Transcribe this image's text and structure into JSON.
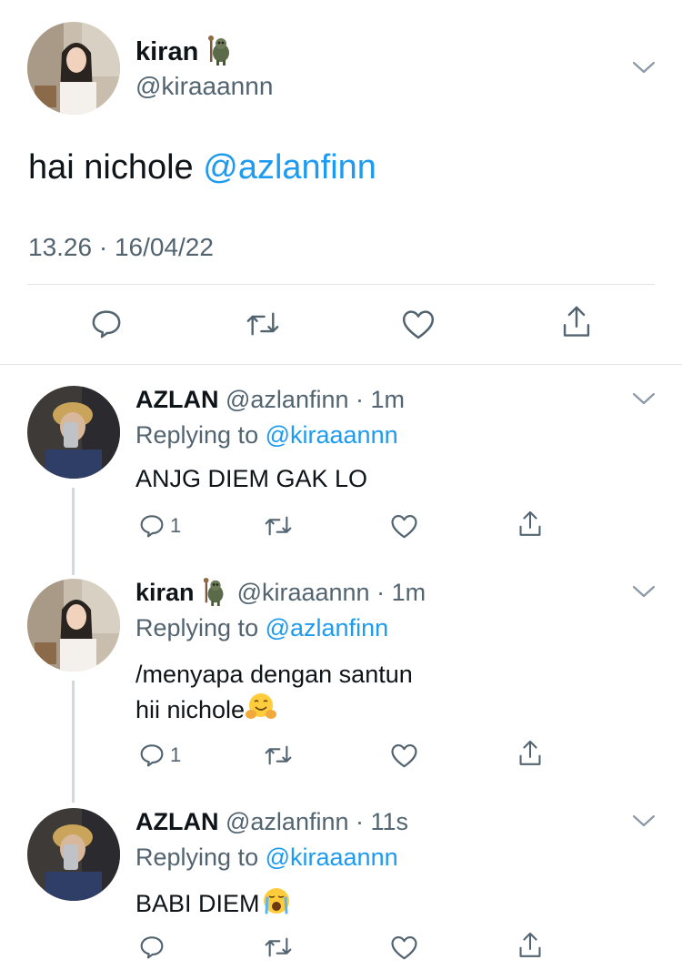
{
  "main_tweet": {
    "display_name": "kiran",
    "handle": "@kiraaannn",
    "text": "hai nichole",
    "mention": "@azlanfinn",
    "timestamp": "13.26 · 16/04/22"
  },
  "replies": [
    {
      "display_name": "AZLAN",
      "handle": "@azlanfinn",
      "time": "· 1m",
      "replying_label": "Replying to",
      "replying_to": "@kiraaannn",
      "text_lines": [
        "ANJG DIEM GAK LO"
      ],
      "reply_count": "1"
    },
    {
      "display_name": "kiran",
      "handle": "@kiraaannn",
      "time": "· 1m",
      "replying_label": "Replying to",
      "replying_to": "@azlanfinn",
      "text_lines": [
        "/menyapa dengan santun",
        "hii nichole"
      ],
      "reply_count": "1"
    },
    {
      "display_name": "AZLAN",
      "handle": "@azlanfinn",
      "time": "· 11s",
      "replying_label": "Replying to",
      "replying_to": "@kiraaannn",
      "text_lines": [
        "BABI DIEM"
      ],
      "reply_count": ""
    }
  ],
  "icons": [
    "reply-icon",
    "retweet-icon",
    "like-icon",
    "share-icon",
    "chevron-down-icon"
  ],
  "colors": {
    "link": "#1d9bf0",
    "secondary_text": "#536471",
    "divider": "#e1e4e8"
  }
}
